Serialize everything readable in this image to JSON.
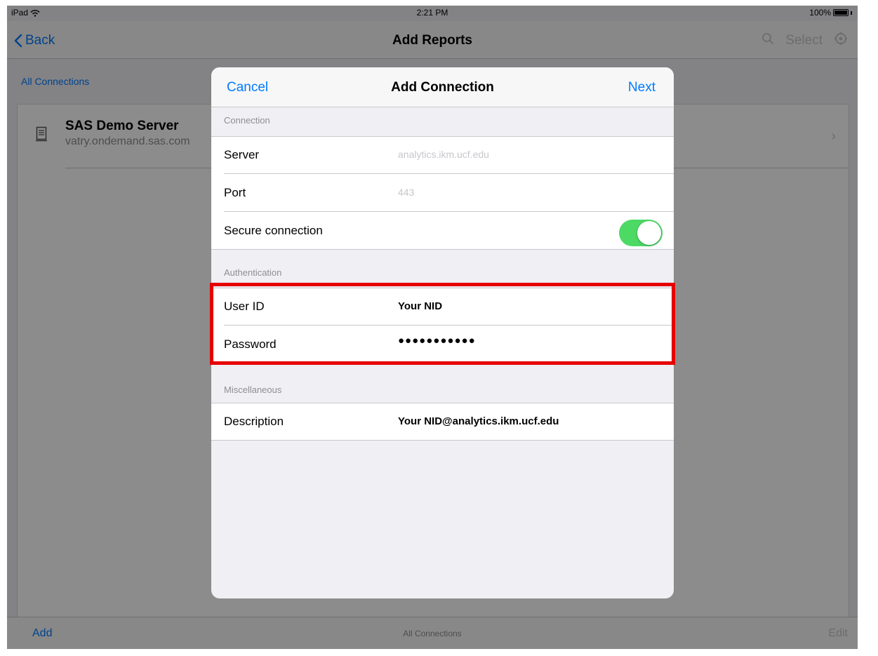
{
  "statusbar": {
    "device": "iPad",
    "time": "2:21 PM",
    "battery": "100%"
  },
  "navbar": {
    "back_label": "Back",
    "title": "Add Reports",
    "select_label": "Select"
  },
  "main": {
    "section_label": "All Connections",
    "connections": [
      {
        "name": "SAS Demo Server",
        "url": "vatry.ondemand.sas.com"
      }
    ]
  },
  "toolbar": {
    "add_label": "Add",
    "center_label": "All Connections",
    "edit_label": "Edit"
  },
  "modal": {
    "cancel_label": "Cancel",
    "title": "Add Connection",
    "next_label": "Next",
    "sections": {
      "connection": "Connection",
      "authentication": "Authentication",
      "miscellaneous": "Miscellaneous"
    },
    "server": {
      "label": "Server",
      "placeholder": "analytics.ikm.ucf.edu"
    },
    "port": {
      "label": "Port",
      "placeholder": "443"
    },
    "secure": {
      "label": "Secure connection",
      "on": true
    },
    "user_id": {
      "label": "User ID",
      "value": "Your NID"
    },
    "password": {
      "label": "Password",
      "value": "●●●●●●●●●●●"
    },
    "description": {
      "label": "Description",
      "value": "Your NID@analytics.ikm.ucf.edu"
    }
  },
  "colors": {
    "accent": "#007aff",
    "toggle_on": "#4cd964",
    "highlight": "#e60000"
  },
  "icons": [
    "wifi-icon",
    "battery-icon",
    "back-chevron-icon",
    "search-icon",
    "settings-icon",
    "server-icon",
    "chevron-right-icon"
  ]
}
